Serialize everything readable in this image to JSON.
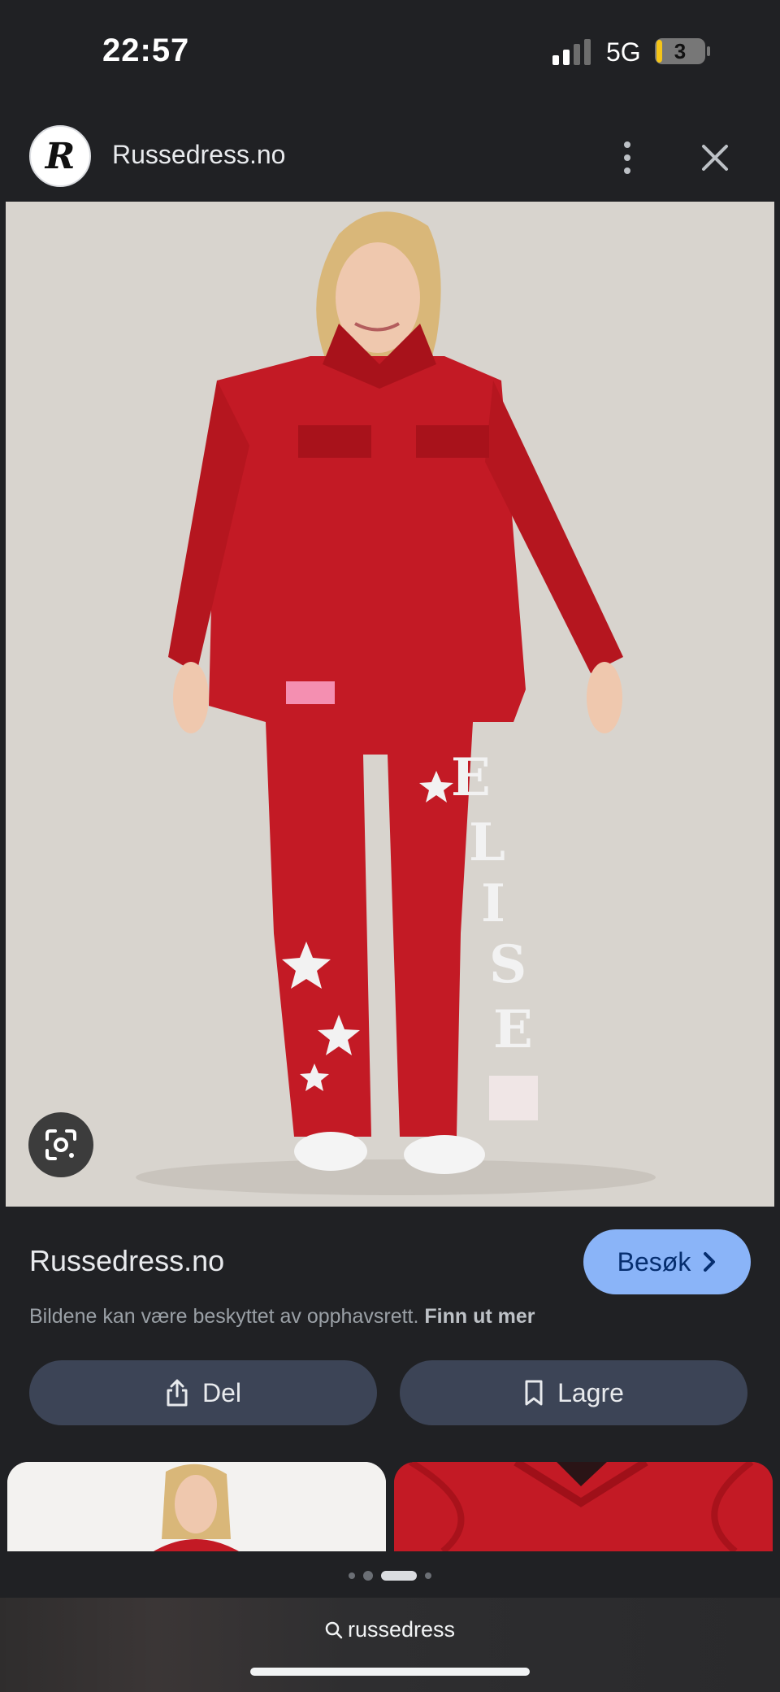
{
  "status_bar": {
    "time": "22:57",
    "network": "5G",
    "battery_level": "3"
  },
  "header": {
    "site_logo_letter": "R",
    "site_title": "Russedress.no"
  },
  "main_image": {
    "icons": [
      "google-lens-icon"
    ]
  },
  "info": {
    "source_name": "Russedress.no",
    "visit_label": "Besøk",
    "copyright_text": "Bildene kan være beskyttet av opphavsrett.",
    "learn_more_label": "Finn ut mer"
  },
  "actions": {
    "share_label": "Del",
    "save_label": "Lagre"
  },
  "pager": {
    "active_index": 2,
    "count": 4
  },
  "bottom_bar": {
    "url_text": "russedress"
  },
  "colors": {
    "background": "#202124",
    "accent": "#8ab4f8",
    "action_button": "#3c4456",
    "jumpsuit_red": "#c31a25"
  }
}
